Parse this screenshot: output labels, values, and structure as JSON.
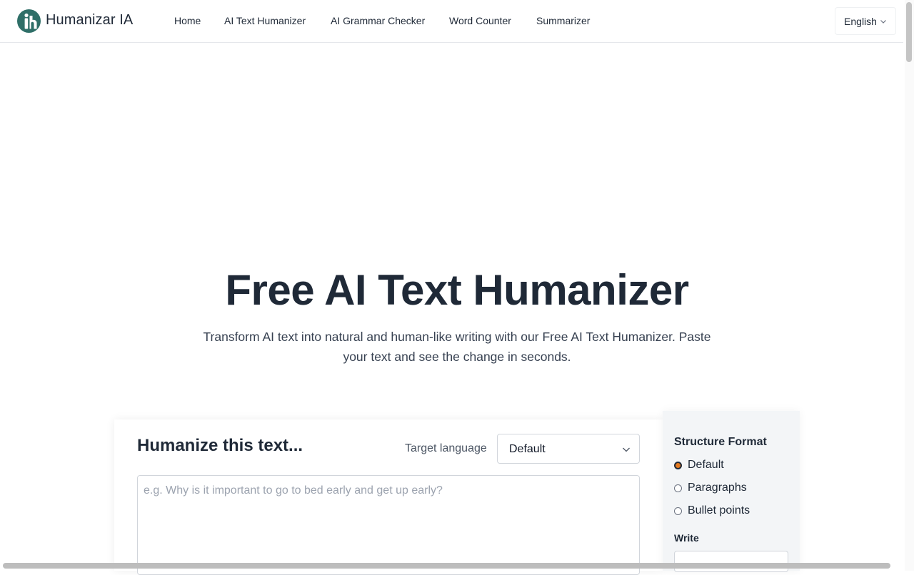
{
  "header": {
    "brand": "Humanizar IA",
    "nav": [
      {
        "label": "Home"
      },
      {
        "label": "AI Text Humanizer"
      },
      {
        "label": "AI Grammar Checker"
      },
      {
        "label": "Word Counter"
      },
      {
        "label": "Summarizer"
      }
    ],
    "language": "English"
  },
  "hero": {
    "title": "Free AI Text Humanizer",
    "subtitle_line1": "Transform AI text into natural and human-like writing with our Free AI Text Humanizer. Paste",
    "subtitle_line2": "your text and see the change in seconds."
  },
  "humanizer": {
    "title": "Humanize this text...",
    "target_language_label": "Target language",
    "target_language_value": "Default",
    "input_placeholder": "e.g. Why is it important to go to bed early and get up early?"
  },
  "structure": {
    "title": "Structure Format",
    "options": [
      {
        "label": "Default",
        "checked": true
      },
      {
        "label": "Paragraphs",
        "checked": false
      },
      {
        "label": "Bullet points",
        "checked": false
      }
    ],
    "write_label": "Write"
  },
  "colors": {
    "brand": "#2f6f68",
    "radio_checked": "#e4791f",
    "text": "#1f2937"
  },
  "icons": {
    "logo": "humanizar-logo-icon",
    "language_chevron": "chevron-down-icon",
    "select_chevron": "chevron-down-icon"
  }
}
